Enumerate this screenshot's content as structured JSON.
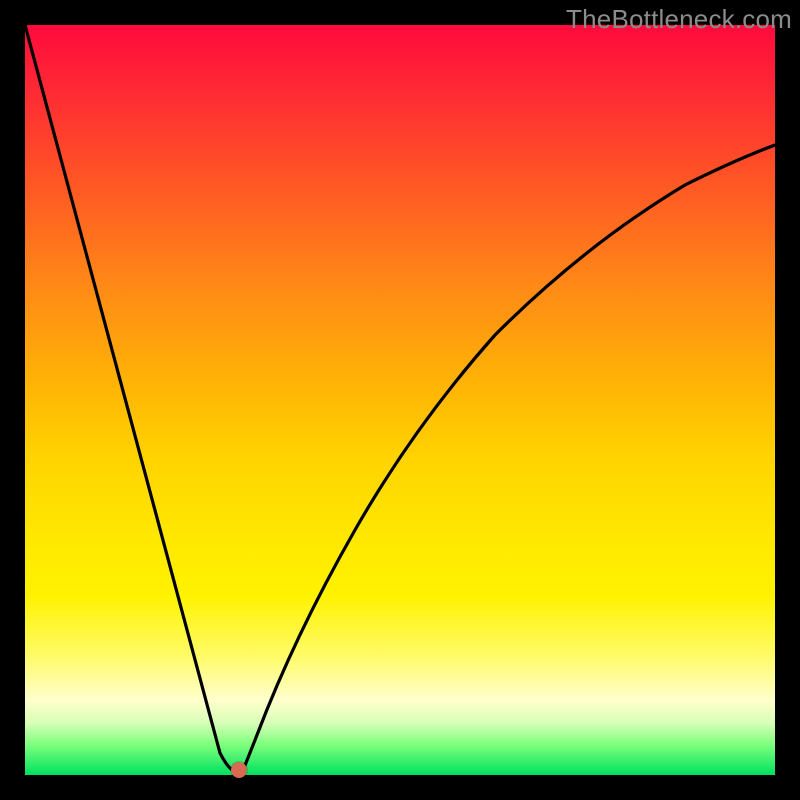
{
  "watermark_text": "TheBottleneck.com",
  "chart_data": {
    "type": "line",
    "title": "",
    "xlabel": "",
    "ylabel": "",
    "xlim": [
      0,
      100
    ],
    "ylim": [
      0,
      100
    ],
    "x": [
      0,
      2,
      4,
      6,
      8,
      10,
      12,
      14,
      16,
      18,
      20,
      22,
      24,
      26,
      27,
      28,
      29,
      30,
      31,
      32,
      33,
      34,
      36,
      38,
      40,
      42,
      45,
      48,
      52,
      56,
      60,
      65,
      70,
      75,
      80,
      85,
      90,
      95,
      100
    ],
    "values": [
      100,
      93,
      86,
      79,
      72,
      65,
      58,
      51,
      44,
      37,
      30,
      23,
      15,
      7,
      2,
      0,
      0,
      1,
      4,
      8,
      13,
      18,
      25,
      31,
      37,
      42,
      48,
      53,
      59,
      64,
      68,
      72,
      76,
      79,
      82,
      84,
      86,
      88,
      89
    ],
    "series_name": "bottleneck-curve",
    "marker": {
      "x": 28.5,
      "y": 0.8
    },
    "notes": "Background is a vertical red→yellow→green gradient. The black curve is V-shaped with minimum near x≈28; right arm is a concave asymptotic rise. A small red dot marks the minimum."
  },
  "layout": {
    "frame_left": 25,
    "frame_top": 25,
    "frame_size": 750,
    "marker_diameter_px": 16
  },
  "colors": {
    "frame": "#000000",
    "curve": "#000000",
    "marker": "#d86a52",
    "watermark": "#8c8c8c"
  }
}
